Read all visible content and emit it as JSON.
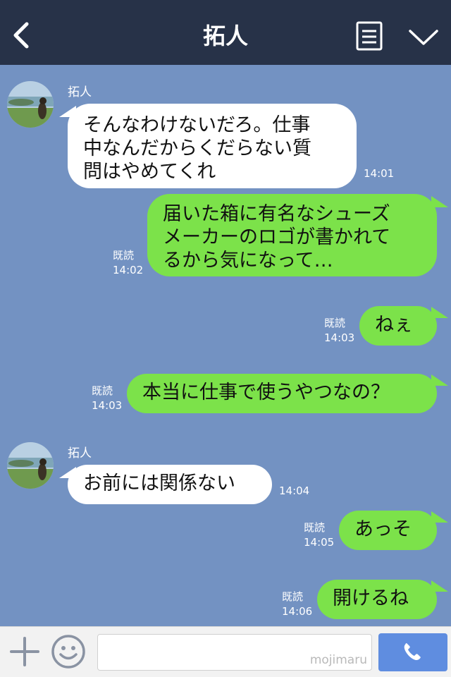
{
  "header": {
    "title": "拓人"
  },
  "messages": [
    {
      "from": "拓人",
      "side": "left",
      "lines": [
        "そんなわけないだろ。仕事",
        "中なんだからくだらない質",
        "問はやめてくれ"
      ],
      "time": "14:01"
    },
    {
      "side": "right",
      "lines": [
        "届いた箱に有名なシューズ",
        "メーカーのロゴが書かれて",
        "るから気になって…"
      ],
      "read": "既読",
      "time": "14:02"
    },
    {
      "side": "right",
      "lines": [
        "ねぇ"
      ],
      "read": "既読",
      "time": "14:03"
    },
    {
      "side": "right",
      "lines": [
        "本当に仕事で使うやつなの？"
      ],
      "read": "既読",
      "time": "14:03"
    },
    {
      "from": "拓人",
      "side": "left",
      "lines": [
        "お前には関係ない"
      ],
      "time": "14:04"
    },
    {
      "side": "right",
      "lines": [
        "あっそ"
      ],
      "read": "既読",
      "time": "14:05"
    },
    {
      "side": "right",
      "lines": [
        "開けるね"
      ],
      "read": "既読",
      "time": "14:06"
    }
  ],
  "input": {
    "placeholder": "",
    "watermark": "mojimaru"
  },
  "icons": {
    "back": "chevron-left-icon",
    "menu": "notes-icon",
    "collapse": "chevron-down-icon",
    "plus": "plus-icon",
    "sticker": "smiley-icon",
    "send": "phone-icon"
  },
  "colors": {
    "header_bg": "#273248",
    "chat_bg": "#7392c2",
    "sent_bubble": "#7ce24a",
    "received_bubble": "#ffffff",
    "send_button": "#5f8de0"
  }
}
